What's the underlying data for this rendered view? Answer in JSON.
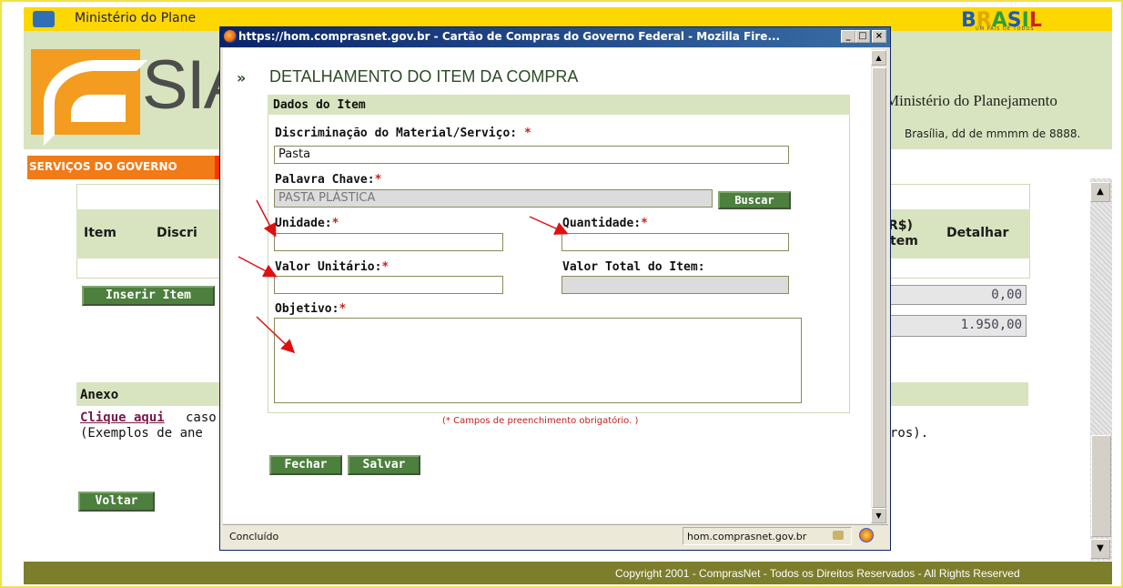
{
  "background": {
    "gov_bar_text": "Ministério do Plane",
    "brasil_logo": "BRASIL",
    "brasil_tagline": "UM PAÍS DE TODOS",
    "siasg_text": "SIA",
    "ministerio": "Ministério do Planejamento",
    "dateline": "Brasília, dd de mmmm de 8888.",
    "servicos_tab": "SERVIÇOS DO GOVERNO",
    "table_headers": [
      "Item",
      "Discri",
      "R$)",
      "tem",
      "Detalhar"
    ],
    "inserir_label": "Inserir Item",
    "value_1": "0,00",
    "value_2": "1.950,00",
    "anexo_title": "Anexo",
    "clique_link": "Clique aqui",
    "caso_text": "caso",
    "exemplos_text": "(Exemplos de ane",
    "ros_text": "ros).",
    "voltar_label": "Voltar",
    "footer": "Copyright 2001 - ComprasNet - Todos os Direitos Reservados - All Rights Reserved"
  },
  "popup": {
    "window_title": "https://hom.comprasnet.gov.br - Cartão de Compras do Governo Federal - Mozilla Fire...",
    "heading": "DETALHAMENTO DO ITEM DA COMPRA",
    "section_title": "Dados do Item",
    "fields": {
      "discriminacao_label": "Discriminação do Material/Serviço: ",
      "discriminacao_value": "Pasta",
      "palavra_label": "Palavra Chave:",
      "palavra_value": "PASTA PLÁSTICA",
      "buscar_label": "Buscar",
      "unidade_label": "Unidade:",
      "unidade_value": "",
      "quantidade_label": "Quantidade:",
      "quantidade_value": "",
      "valor_unitario_label": "Valor Unitário:",
      "valor_unitario_value": "",
      "valor_total_label": "Valor Total do Item:",
      "valor_total_value": "",
      "objetivo_label": "Objetivo:",
      "objetivo_value": "",
      "required_mark": "*"
    },
    "required_note": "(* Campos de preenchimento obrigatório. )",
    "fechar_label": "Fechar",
    "salvar_label": "Salvar",
    "status_text": "Concluído",
    "status_url": "hom.comprasnet.gov.br"
  },
  "colors": {
    "header_green": "#d8e4bf",
    "button_green": "#4d7f3e",
    "annotation_arrow": "#e01010",
    "gov_yellow": "#fdd700",
    "footer_olive": "#7c7e2c"
  }
}
